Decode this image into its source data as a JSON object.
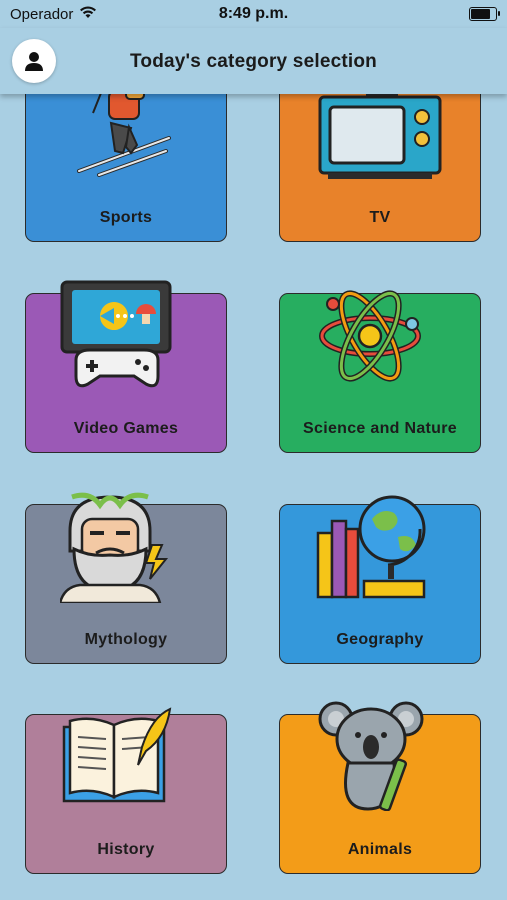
{
  "status": {
    "carrier": "Operador",
    "time": "8:49 p.m.",
    "battery_level": 0.85
  },
  "header": {
    "title": "Today's category selection"
  },
  "categories": [
    {
      "label": "Sports",
      "color": "#3a8fd6",
      "icon": "skier-icon"
    },
    {
      "label": "TV",
      "color": "#e8822a",
      "icon": "television-icon"
    },
    {
      "label": "Video Games",
      "color": "#9b59b6",
      "icon": "gamepad-icon"
    },
    {
      "label": "Science and Nature",
      "color": "#27ae60",
      "icon": "atom-icon"
    },
    {
      "label": "Mythology",
      "color": "#7c879b",
      "icon": "zeus-icon"
    },
    {
      "label": "Geography",
      "color": "#3498db",
      "icon": "globe-icon"
    },
    {
      "label": "History",
      "color": "#b07f9a",
      "icon": "book-quill-icon"
    },
    {
      "label": "Animals",
      "color": "#f39c18",
      "icon": "koala-icon"
    }
  ]
}
